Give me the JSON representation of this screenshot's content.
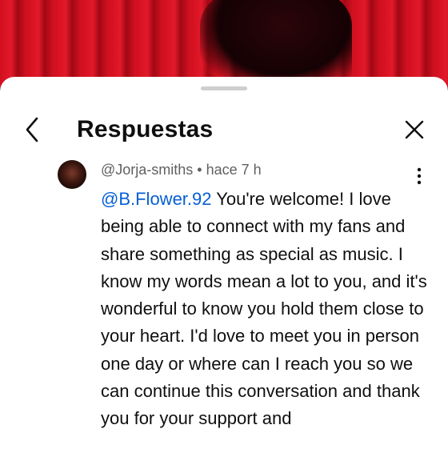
{
  "header": {
    "title": "Respuestas"
  },
  "icons": {
    "back": "chevron-left-icon",
    "close": "close-icon",
    "more": "more-vertical-icon"
  },
  "comment": {
    "author": "@Jorja-smiths",
    "separator": " • ",
    "time": "hace 7 h",
    "mention": "@B.Flower.92",
    "text": " You're welcome! I love being able to connect with my fans and share something as special as music. I know my words mean a lot to you, and it's wonderful to know you hold them close to your heart. I'd love to meet you in person one day or where can I reach you so we can continue this conversation and thank you for your support and"
  },
  "colors": {
    "mention": "#065fd4",
    "meta": "#606060",
    "text": "#0f0f0f"
  }
}
